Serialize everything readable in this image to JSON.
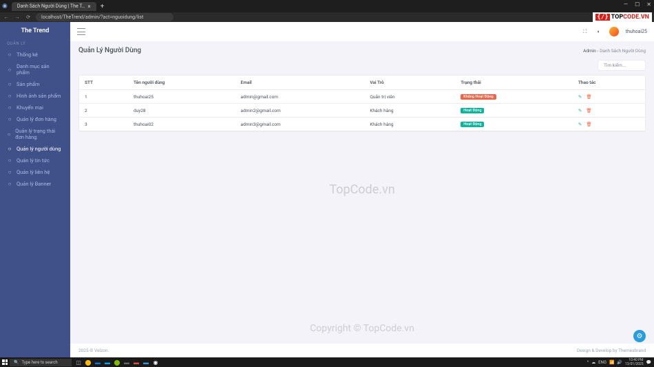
{
  "browser": {
    "tab_title": "Danh Sách Người Dùng | The T…",
    "url": "localhost/TheTrend/admin/?act=nguoidung/list"
  },
  "brand": "The Trend",
  "sidebar": {
    "section_label": "QUẢN LÝ",
    "items": [
      {
        "label": "Thống kê"
      },
      {
        "label": "Danh mục sản phẩm"
      },
      {
        "label": "Sản phẩm"
      },
      {
        "label": "Hình ảnh sản phẩm"
      },
      {
        "label": "Khuyến mại"
      },
      {
        "label": "Quản lý đơn hàng"
      },
      {
        "label": "Quản lý trạng thái đơn hàng"
      },
      {
        "label": "Quản lý người dùng"
      },
      {
        "label": "Quản lý tin tức"
      },
      {
        "label": "Quản lý liên hệ"
      },
      {
        "label": "Quản lý Banner"
      }
    ]
  },
  "user": {
    "name": "thuhoai25"
  },
  "page": {
    "title": "Quản Lý Người Dùng",
    "crumb1": "Admin",
    "crumb2": "Danh Sách Người Dùng"
  },
  "search_placeholder": "Tìm kiếm...",
  "table": {
    "headers": {
      "stt": "STT",
      "name": "Tên người dùng",
      "email": "Email",
      "role": "Vai Trò",
      "status": "Trạng thái",
      "action": "Thao tác"
    },
    "rows": [
      {
        "stt": "1",
        "name": "thuhoai25",
        "email": "admin@gmail.com",
        "role": "Quản trị viên",
        "status": "Không Hoạt Động",
        "status_cls": "badge-danger"
      },
      {
        "stt": "2",
        "name": "duy28",
        "email": "admin2@gmail.com",
        "role": "Khách hàng",
        "status": "Hoạt Động",
        "status_cls": "badge-success"
      },
      {
        "stt": "3",
        "name": "thuhoai02",
        "email": "admin3@gmail.com",
        "role": "Khách hàng",
        "status": "Hoạt Động",
        "status_cls": "badge-success"
      }
    ]
  },
  "footer": {
    "left": "2025 © Velzon.",
    "right": "Design & Develop by Themesbrand"
  },
  "watermark1": "TopCode.vn",
  "watermark2": "Copyright © TopCode.vn",
  "logo_tc": {
    "ico": "{/}",
    "t1": "TOP",
    "t2": "CODE.VN"
  },
  "taskbar": {
    "search": "Type here to search",
    "time": "10:40 PM",
    "date": "13/01/2025"
  }
}
